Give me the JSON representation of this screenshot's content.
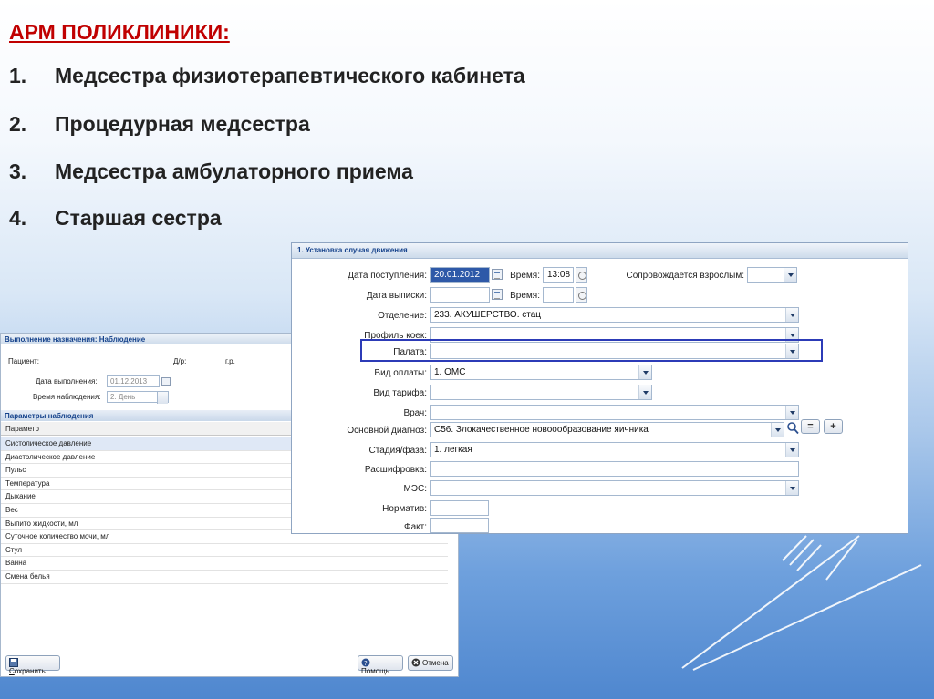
{
  "slide": {
    "title": "АРМ ПОЛИКЛИНИКИ:",
    "items": [
      {
        "num": "1.",
        "text": "Медсестра физиотерапевтического кабинета"
      },
      {
        "num": "2.",
        "text": "Процедурная медсестра"
      },
      {
        "num": "3.",
        "text": "Медсестра амбулаторного приема"
      },
      {
        "num": "4.",
        "text": "Старшая сестра"
      }
    ]
  },
  "observation": {
    "title": "Выполнение назначения: Наблюдение",
    "patient_label": "Пациент:",
    "dob_label": "Д/р:",
    "year_label": "г.р.",
    "date_label": "Дата выполнения:",
    "date_value": "01.12.2013",
    "time_label": "Время наблюдения:",
    "time_value": "2. День",
    "params_title": "Параметры наблюдения",
    "column_header": "Параметр",
    "rows": [
      "Систолическое давление",
      "Диастолическое давление",
      "Пульс",
      "Температура",
      "Дыхание",
      "Вес",
      "Выпито жидкости, мл",
      "Суточное количество мочи, мл",
      "Стул",
      "Ванна",
      "Смена белья"
    ],
    "save_u": "С",
    "save_rest": "охранить",
    "help_label": "Помощь",
    "cancel_label": "Отмена"
  },
  "form": {
    "title": "1. Установка случая движения",
    "admission_date_label": "Дата поступления:",
    "admission_date_value": "20.01.2012",
    "time_label": "Время:",
    "admission_time_value": "13:08",
    "accompanied_label": "Сопровождается взрослым:",
    "accompanied_value": "",
    "discharge_date_label": "Дата выписки:",
    "discharge_date_value": "",
    "discharge_time_label": "Время:",
    "discharge_time_value": "",
    "department_label": "Отделение:",
    "department_value": "233. АКУШЕРСТВО. стац",
    "bed_profile_label": "Профиль коек:",
    "bed_profile_value": "",
    "ward_label": "Палата:",
    "ward_value": "",
    "payment_label": "Вид оплаты:",
    "payment_value": "1. ОМС",
    "tariff_label": "Вид тарифа:",
    "tariff_value": "",
    "doctor_label": "Врач:",
    "doctor_value": "",
    "diagnosis_label": "Основной диагноз:",
    "diagnosis_value": "С56. Злокачественное новоообразование яичника",
    "eq_label": "=",
    "plus_label": "+",
    "stage_label": "Стадия/фаза:",
    "stage_value": "1. легкая",
    "decoding_label": "Расшифровка:",
    "decoding_value": "",
    "mes_label": "МЭС:",
    "mes_value": "",
    "norm_label": "Норматив:",
    "norm_value": "",
    "fact_label": "Факт:",
    "fact_value": ""
  }
}
